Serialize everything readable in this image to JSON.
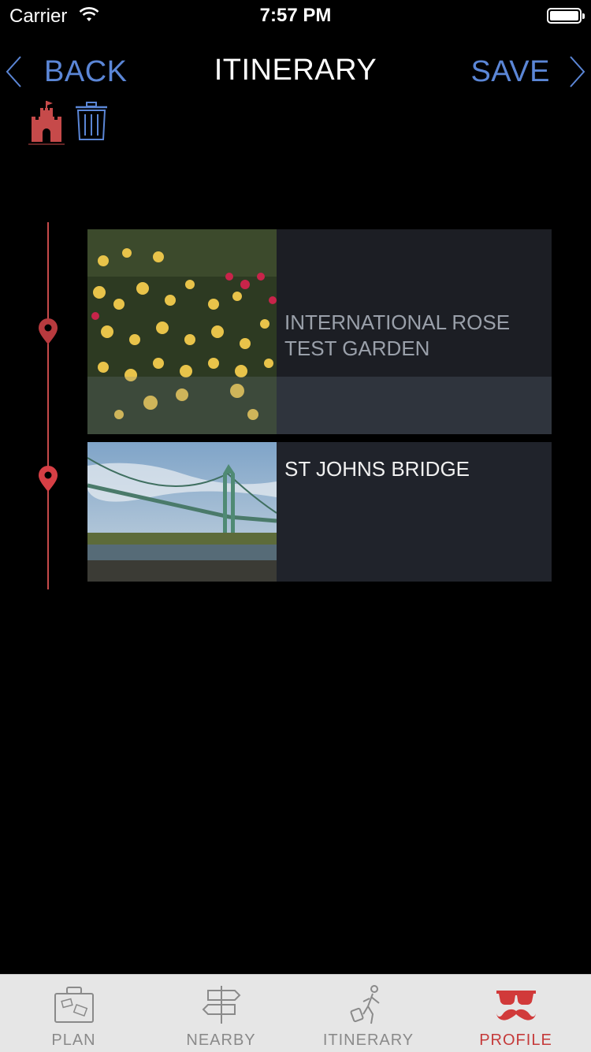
{
  "status_bar": {
    "carrier": "Carrier",
    "time": "7:57 PM"
  },
  "nav": {
    "back_label": "BACK",
    "title": "ITINERARY",
    "save_label": "SAVE"
  },
  "colors": {
    "accent_blue": "#5b86d6",
    "timeline_red": "#c64a4a",
    "active_tab": "#c53a3a"
  },
  "itinerary": [
    {
      "name": "INTERNATIONAL ROSE TEST GARDEN",
      "image": "rose-garden-photo"
    },
    {
      "name": "ST JOHNS BRIDGE",
      "image": "bridge-photo"
    }
  ],
  "tabs": [
    {
      "label": "PLAN",
      "icon": "luggage-icon",
      "active": false
    },
    {
      "label": "NEARBY",
      "icon": "signpost-icon",
      "active": false
    },
    {
      "label": "ITINERARY",
      "icon": "traveler-icon",
      "active": false
    },
    {
      "label": "PROFILE",
      "icon": "mustache-glasses-icon",
      "active": true
    }
  ]
}
